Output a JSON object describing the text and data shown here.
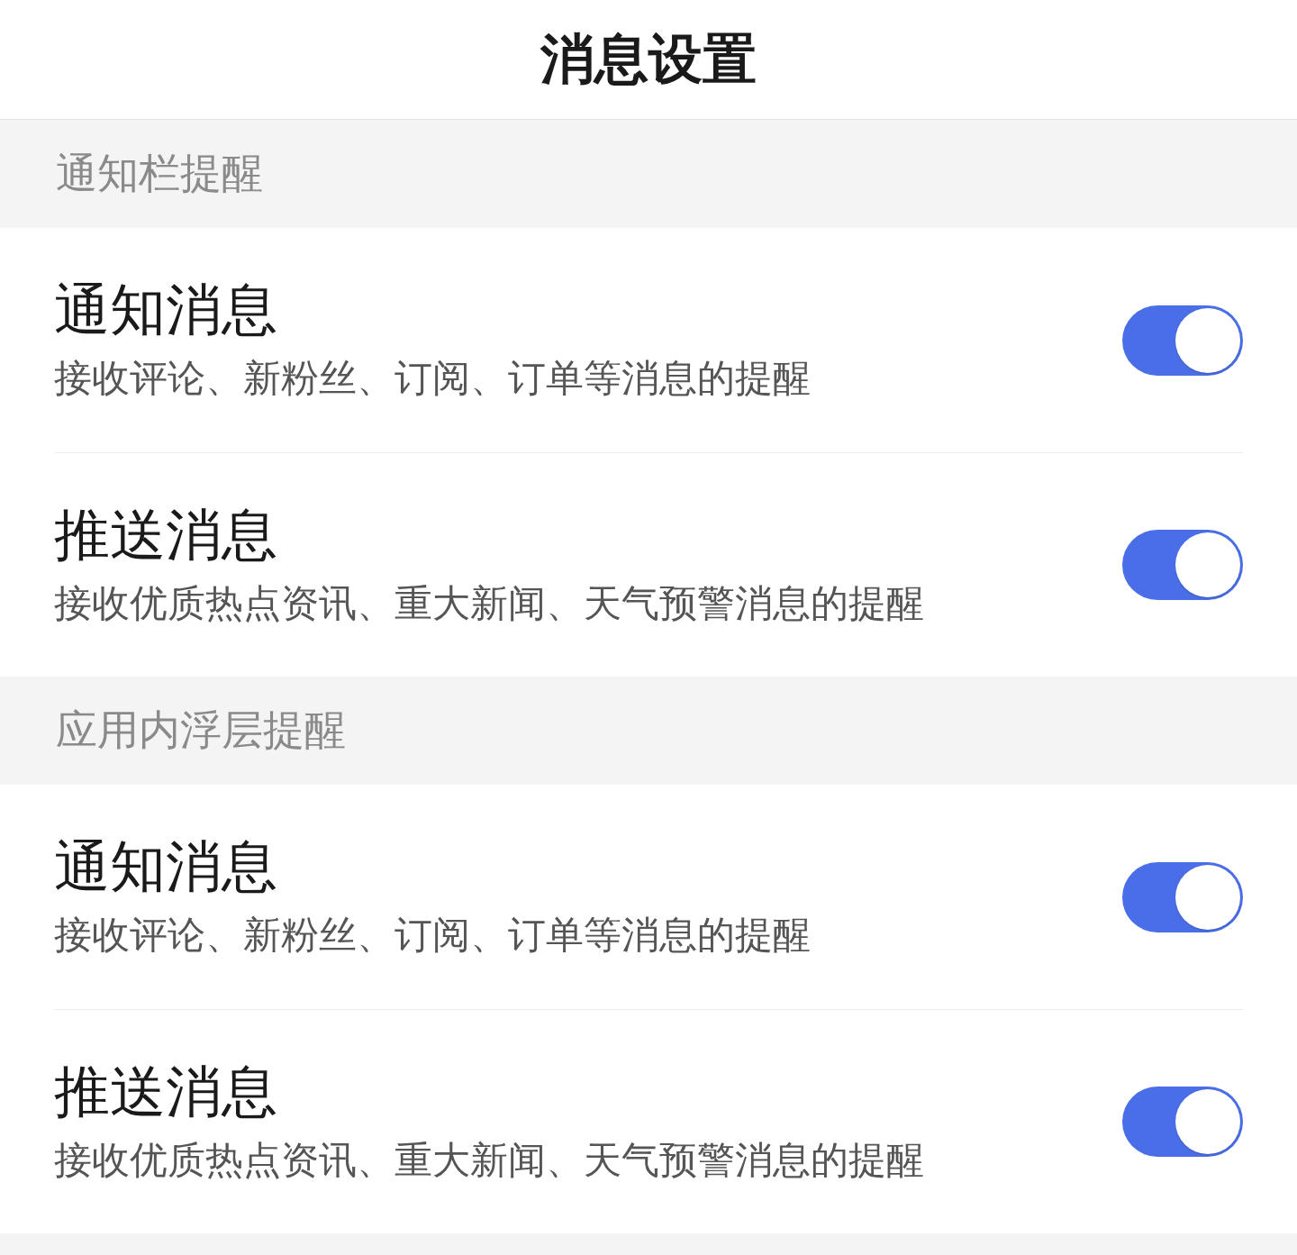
{
  "title": "消息设置",
  "sections": [
    {
      "header": "通知栏提醒",
      "items": [
        {
          "title": "通知消息",
          "subtitle": "接收评论、新粉丝、订阅、订单等消息的提醒",
          "on": true
        },
        {
          "title": "推送消息",
          "subtitle": "接收优质热点资讯、重大新闻、天气预警消息的提醒",
          "on": true
        }
      ]
    },
    {
      "header": "应用内浮层提醒",
      "items": [
        {
          "title": "通知消息",
          "subtitle": "接收评论、新粉丝、订阅、订单等消息的提醒",
          "on": true
        },
        {
          "title": "推送消息",
          "subtitle": "接收优质热点资讯、重大新闻、天气预警消息的提醒",
          "on": true
        }
      ]
    }
  ]
}
